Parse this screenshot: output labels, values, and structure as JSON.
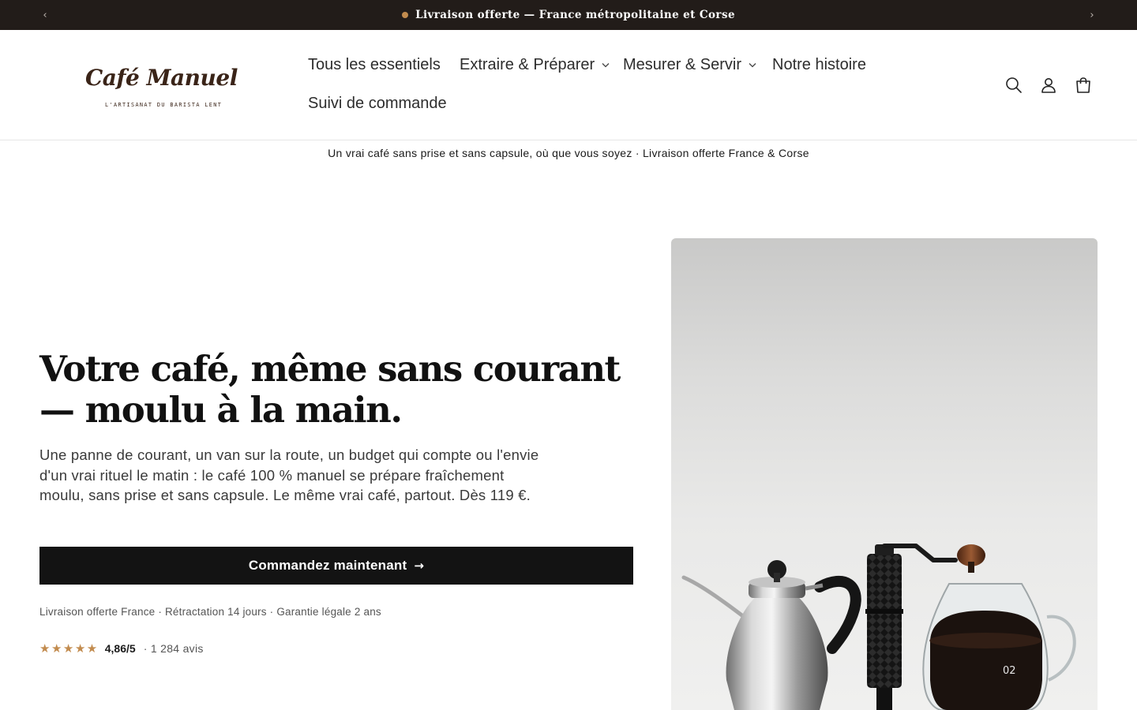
{
  "announcement": {
    "text": "Livraison offerte — France métropolitaine et Corse",
    "prev_label": "‹",
    "next_label": "›",
    "dot_color": "#c28b4e"
  },
  "brand": {
    "name": "Café Manuel",
    "tagline": "L'ARTISANAT DU BARISTA LENT"
  },
  "nav": {
    "items": [
      {
        "label": "Tous les essentiels",
        "has_dropdown": false
      },
      {
        "label": "Extraire & Préparer",
        "has_dropdown": true
      },
      {
        "label": "Mesurer & Servir",
        "has_dropdown": true
      },
      {
        "label": "Notre histoire",
        "has_dropdown": false
      },
      {
        "label": "Suivi de commande",
        "has_dropdown": false
      }
    ],
    "chevron": "⌄"
  },
  "header_icons": [
    "search-icon",
    "account-icon",
    "cart-icon"
  ],
  "subline": "Un vrai café sans prise et sans capsule, où que vous soyez · Livraison offerte France & Corse",
  "hero": {
    "title": "Votre café, même sans courant — moulu à la main.",
    "description": "Une panne de courant, un van sur la route, un budget qui compte ou l'envie d'un vrai rituel le matin : le café 100 % manuel se prépare fraîchement moulu, sans prise et sans capsule. Le même vrai café, partout. Dès 119 €.",
    "cta_label": "Commandez maintenant",
    "cta_arrow": "→",
    "assurances": "Livraison offerte France · Rétractation 14 jours · Garantie légale 2 ans",
    "stars": "★★★★★",
    "rating_stars": 5,
    "score": "4,86/5",
    "reviews": "· 1 284 avis",
    "server_label": "02"
  },
  "colors": {
    "announcement_bg": "#221c19",
    "accent": "#c28b4e",
    "cta_bg": "#131313",
    "logo_brown": "#3a2418"
  }
}
